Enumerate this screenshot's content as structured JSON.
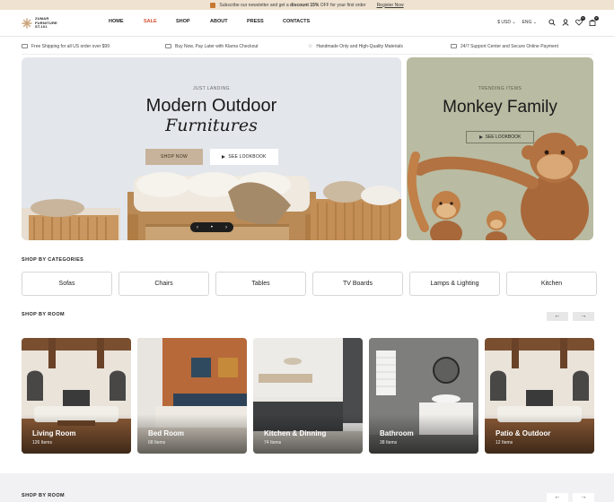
{
  "announcement": {
    "text_before": "Subscribe our newsletter and get a ",
    "text_bold": "discount 15%",
    "text_after": " OFF for your first order",
    "link": "Register Now"
  },
  "logo": {
    "line1": "ZUMAR",
    "line2": "FURNITURE",
    "line3": "ST.101"
  },
  "nav": [
    "HOME",
    "SALE",
    "SHOP",
    "ABOUT",
    "PRESS",
    "CONTACTS"
  ],
  "header": {
    "currency": "$ USD",
    "language": "ENG",
    "wishlist_count": "0",
    "cart_count": "0"
  },
  "features": [
    "Free Shipping for all US order over $99",
    "Buy Now, Pay Later with Klarna Checkout",
    "Handmade Only and High-Quality Materials",
    "24/7 Support Center and Secure Online Payment"
  ],
  "hero": {
    "eyebrow": "JUST LANDING",
    "title": "Modern Outdoor",
    "subtitle": "Furnitures",
    "shop_button": "SHOP NOW",
    "lookbook_button": "SEE LOOKBOOK",
    "slider_prev": "‹",
    "slider_next": "›"
  },
  "side_banner": {
    "eyebrow": "TRENDING ITEMS",
    "title": "Monkey Family",
    "lookbook_button": "SEE LOOKBOOK"
  },
  "categories_section": {
    "title": "SHOP BY CATEGORIES",
    "items": [
      "Sofas",
      "Chairs",
      "Tables",
      "TV Boards",
      "Lamps & Lighting",
      "Kitchen"
    ]
  },
  "rooms_section": {
    "title": "SHOP BY ROOM",
    "prev": "←",
    "next": "→",
    "rooms": [
      {
        "name": "Living Room",
        "count": "126 Items"
      },
      {
        "name": "Bed Room",
        "count": "68 Items"
      },
      {
        "name": "Kitchen & Dinning",
        "count": "74 Items"
      },
      {
        "name": "Bathroom",
        "count": "38 Items"
      },
      {
        "name": "Patio & Outdoor",
        "count": "12 Items"
      }
    ]
  },
  "rooms_section_2": {
    "title": "SHOP BY ROOM"
  },
  "colors": {
    "accent_sale": "#d24c2e",
    "button_tan": "#c7b39b",
    "announcement_bg": "#efe2d0"
  }
}
